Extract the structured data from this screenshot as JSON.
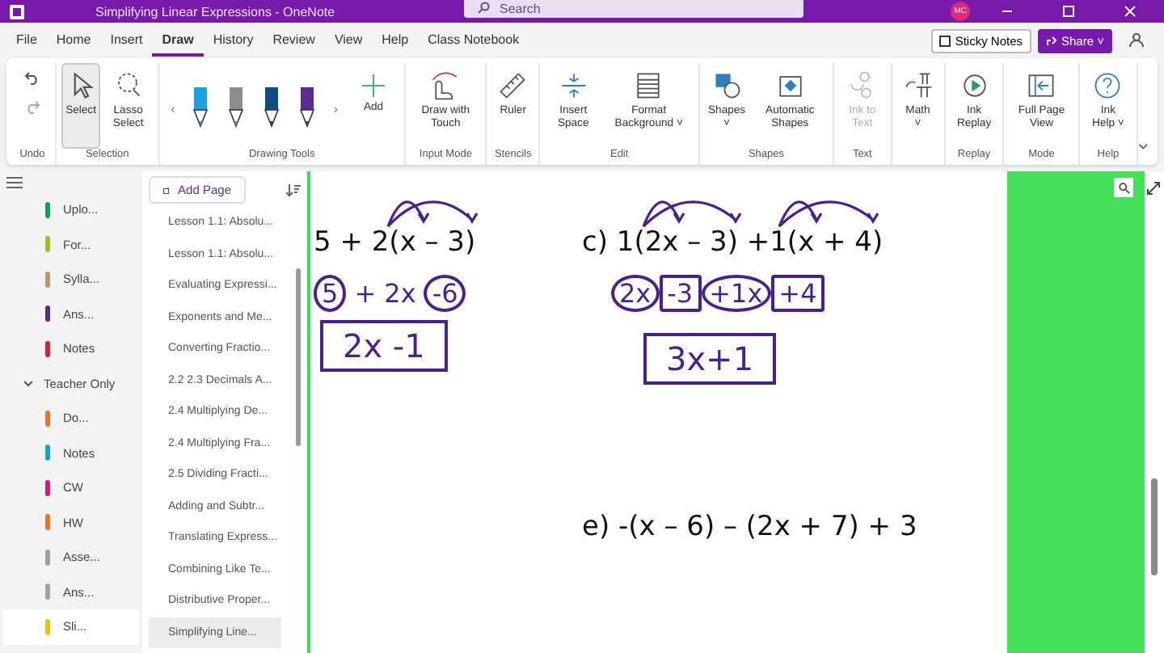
{
  "window": {
    "title": "Simplifying Linear Expressions - OneNote",
    "search_placeholder": "Search",
    "avatar": "MC"
  },
  "menu": [
    {
      "label": "File",
      "selected": false
    },
    {
      "label": "Home",
      "selected": false
    },
    {
      "label": "Insert",
      "selected": false
    },
    {
      "label": "Draw",
      "selected": true
    },
    {
      "label": "History",
      "selected": false
    },
    {
      "label": "Review",
      "selected": false
    },
    {
      "label": "View",
      "selected": false
    },
    {
      "label": "Help",
      "selected": false
    },
    {
      "label": "Class Notebook",
      "selected": false
    }
  ],
  "menu_buttons": {
    "sticky_notes": "Sticky Notes",
    "share": "Share",
    "share_caret": "˅"
  },
  "ribbon": [
    {
      "group": "Undo",
      "items": [
        {
          "kind": "undo"
        }
      ]
    },
    {
      "group": "Selection",
      "items": [
        {
          "kind": "select",
          "label": "Select",
          "selected": true
        },
        {
          "kind": "lasso",
          "label": "Lasso Select",
          "selected": false
        }
      ]
    },
    {
      "group": "Drawing Tools",
      "items": [
        {
          "kind": "pens",
          "pens": [
            {
              "color": "#1ba1e2"
            },
            {
              "color": "#8a8d8f"
            },
            {
              "color": "#0f4c81"
            },
            {
              "color": "#5c2d91"
            }
          ],
          "prev": "‹",
          "next": "›",
          "add": "Add"
        }
      ]
    },
    {
      "group": "Input Mode",
      "items": [
        {
          "kind": "touch",
          "label": "Draw with Touch"
        }
      ]
    },
    {
      "group": "Stencils",
      "items": [
        {
          "kind": "ruler",
          "label": "Ruler"
        }
      ]
    },
    {
      "group": "Edit",
      "items": [
        {
          "kind": "space",
          "label": "Insert Space"
        },
        {
          "kind": "background",
          "label": "Format Background",
          "caret": "˅"
        }
      ]
    },
    {
      "group": "Shapes",
      "items": [
        {
          "kind": "shapes",
          "label": "Shapes",
          "caret": "˅"
        },
        {
          "kind": "auto",
          "label": "Automatic Shapes"
        }
      ]
    },
    {
      "group": "Text",
      "items": [
        {
          "kind": "inktext",
          "label": "Ink to Text",
          "disabled": true
        }
      ]
    },
    {
      "items": [
        {
          "kind": "math",
          "label": "Math",
          "caret": "˅"
        }
      ]
    },
    {
      "group": "Replay",
      "items": [
        {
          "kind": "replay",
          "label": "Ink Replay"
        }
      ]
    },
    {
      "group": "Mode",
      "items": [
        {
          "kind": "fullpage",
          "label": "Full Page View"
        }
      ]
    },
    {
      "group": "Help",
      "items": [
        {
          "kind": "help",
          "label": "Ink Help",
          "caret": "˅"
        }
      ]
    }
  ],
  "sections": [
    {
      "label": "Uplo...",
      "color": "#10a050",
      "selected": false
    },
    {
      "label": "For...",
      "color": "#9ac41c",
      "selected": false
    },
    {
      "label": "Sylla...",
      "color": "#b9987a",
      "selected": false
    },
    {
      "label": "Ans...",
      "color": "#5b2a8c",
      "selected": false
    },
    {
      "label": "Notes",
      "color": "#d9203a",
      "selected": false
    },
    {
      "label": "Teacher Only",
      "expanded": true,
      "children": [
        {
          "label": "Do...",
          "color": "#f07020",
          "selected": false
        },
        {
          "label": "Notes",
          "color": "#1aa0d8",
          "selected": false
        },
        {
          "label": "CW",
          "color": "#d81b7a",
          "selected": false
        },
        {
          "label": "HW",
          "color": "#f07020",
          "selected": false
        },
        {
          "label": "Asse...",
          "color": "#a0a0a0",
          "selected": false
        },
        {
          "label": "Ans...",
          "color": "#a0a0a0",
          "selected": false
        },
        {
          "label": "Sli...",
          "color": "#f2c200",
          "selected": true
        }
      ]
    }
  ],
  "pages": {
    "add_page": "Add Page",
    "items": [
      {
        "label": "Lesson 1.1: Absolu...",
        "selected": false
      },
      {
        "label": "Lesson 1.1: Absolu...",
        "selected": false
      },
      {
        "label": "Evaluating Expressi...",
        "selected": false
      },
      {
        "label": "Exponents and Me...",
        "selected": false
      },
      {
        "label": "Converting Fractio...",
        "selected": false
      },
      {
        "label": "2.2 2.3 Decimals A...",
        "selected": false
      },
      {
        "label": "2.4 Multiplying De...",
        "selected": false
      },
      {
        "label": "2.4 Multiplying Fra...",
        "selected": false
      },
      {
        "label": "2.5 Dividing Fracti...",
        "selected": false
      },
      {
        "label": "Adding and Subtr...",
        "selected": false
      },
      {
        "label": "Translating Express...",
        "selected": false
      },
      {
        "label": "Combining Like Te...",
        "selected": false
      },
      {
        "label": "Distributive Proper...",
        "selected": false
      },
      {
        "label": "Simplifying Line...",
        "selected": true
      }
    ]
  },
  "note": {
    "problems": [
      {
        "expression": "5 + 2(x – 3)",
        "terms": [
          {
            "text": "5",
            "kind": "circle"
          },
          {
            "text": "+ 2x",
            "kind": "plain"
          },
          {
            "text": "-6",
            "kind": "circle"
          }
        ],
        "answer": "2x -1"
      },
      {
        "label": "c)",
        "expression": "1(2x – 3) +1(x + 4)",
        "terms": [
          {
            "text": "2x",
            "kind": "circle"
          },
          {
            "text": "-3",
            "kind": "box"
          },
          {
            "text": "+1x",
            "kind": "circle"
          },
          {
            "text": "+4",
            "kind": "box"
          }
        ],
        "answer": "3x+1"
      },
      {
        "label": "e)",
        "expression": "-(x – 6) – (2x + 7) + 3"
      }
    ]
  }
}
